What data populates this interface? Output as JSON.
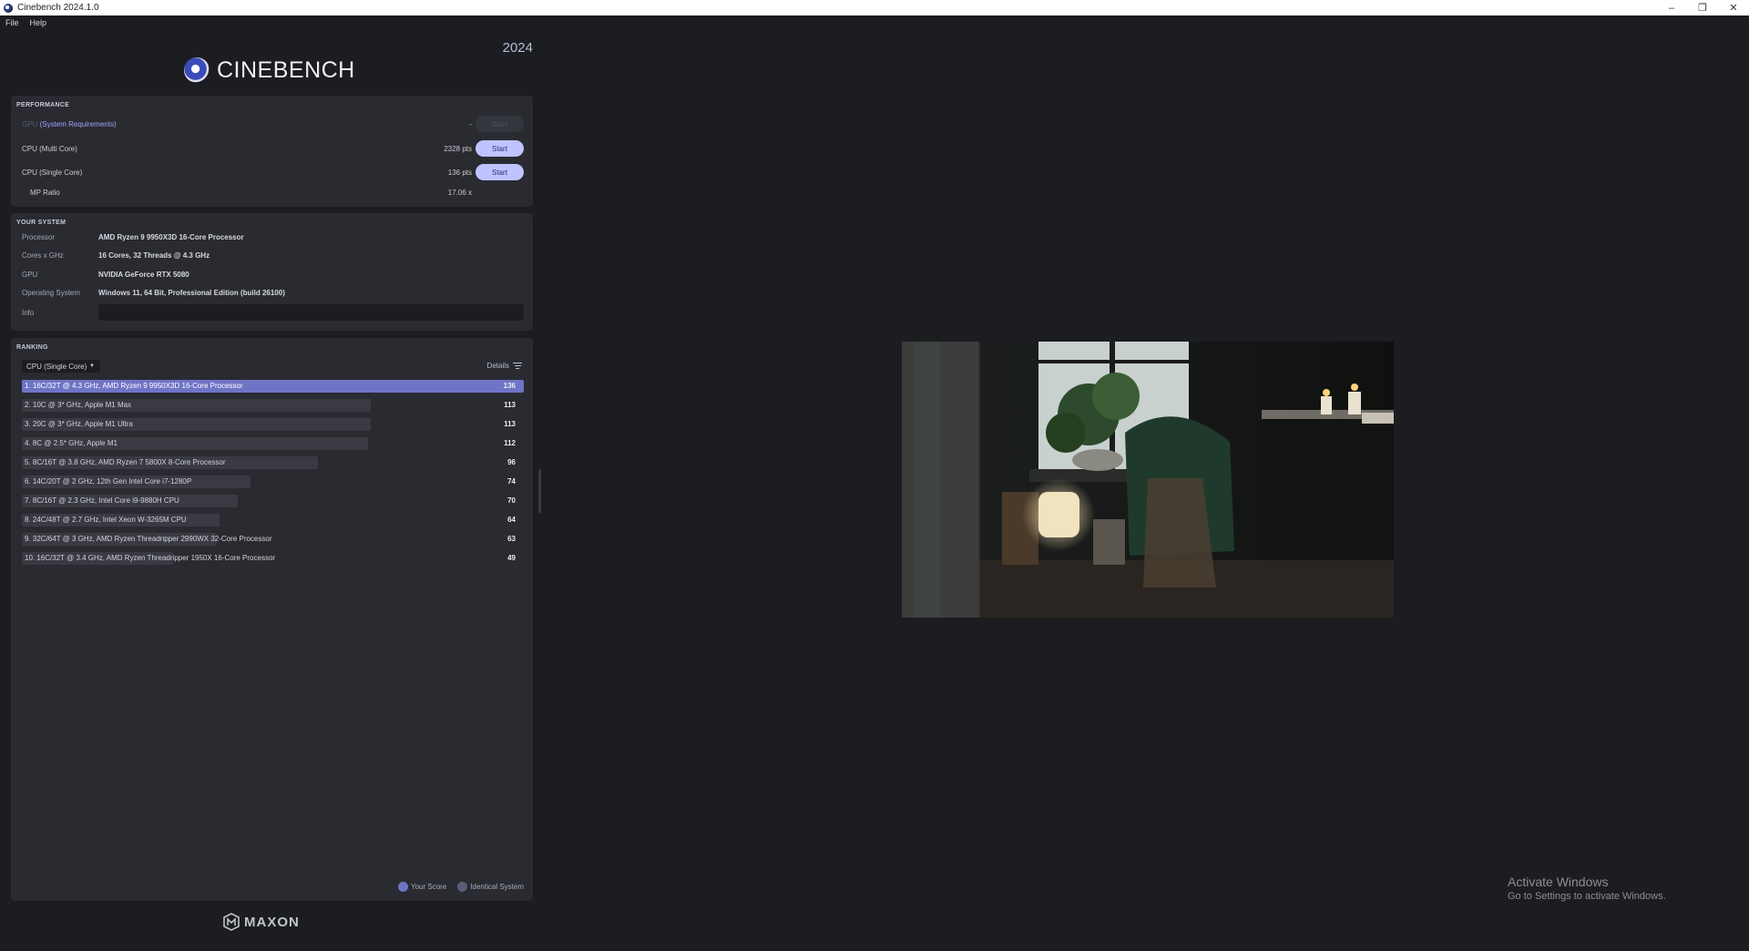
{
  "window": {
    "title": "Cinebench 2024.1.0",
    "controls": [
      "minimize",
      "restore",
      "close"
    ]
  },
  "menu": [
    "File",
    "Help"
  ],
  "header": {
    "logo_text": "CINEBENCH",
    "year": "2024"
  },
  "performance": {
    "title": "PERFORMANCE",
    "gpu": {
      "label_prefix": "GPU",
      "link": "(System Requirements)",
      "score": "-",
      "button": "Start"
    },
    "multi": {
      "label": "CPU (Multi Core)",
      "score": "2328 pts",
      "button": "Start"
    },
    "single": {
      "label": "CPU (Single Core)",
      "score": "136 pts",
      "button": "Start"
    },
    "ratio": {
      "label": "MP Ratio",
      "value": "17.06 x"
    }
  },
  "system": {
    "title": "YOUR SYSTEM",
    "rows": [
      {
        "key": "Processor",
        "value": "AMD Ryzen 9 9950X3D 16-Core Processor"
      },
      {
        "key": "Cores x GHz",
        "value": "16 Cores, 32 Threads @ 4.3 GHz"
      },
      {
        "key": "GPU",
        "value": "NVIDIA GeForce RTX 5080"
      },
      {
        "key": "Operating System",
        "value": "Windows 11, 64 Bit, Professional Edition (build 26100)"
      }
    ],
    "info_label": "Info"
  },
  "ranking": {
    "title": "RANKING",
    "selected": "CPU (Single Core)",
    "details_label": "Details",
    "rows": [
      {
        "name": "1. 16C/32T @ 4.3 GHz, AMD Ryzen 9 9950X3D 16-Core Processor",
        "score": "136",
        "mine": true
      },
      {
        "name": "2. 10C @ 3* GHz, Apple M1 Max",
        "score": "113"
      },
      {
        "name": "3. 20C @ 3* GHz, Apple M1 Ultra",
        "score": "113"
      },
      {
        "name": "4. 8C @ 2.5* GHz, Apple M1",
        "score": "112"
      },
      {
        "name": "5. 8C/16T @ 3.8 GHz, AMD Ryzen 7 5800X 8-Core Processor",
        "score": "96"
      },
      {
        "name": "6. 14C/20T @ 2 GHz, 12th Gen Intel Core i7-1280P",
        "score": "74"
      },
      {
        "name": "7. 8C/16T @ 2.3 GHz, Intel Core i9-9880H CPU",
        "score": "70"
      },
      {
        "name": "8. 24C/48T @ 2.7 GHz, Intel Xeon W-3265M CPU",
        "score": "64"
      },
      {
        "name": "9. 32C/64T @ 3 GHz, AMD Ryzen Threadripper 2990WX 32-Core Processor",
        "score": "63"
      },
      {
        "name": "10. 16C/32T @ 3.4 GHz, AMD Ryzen Threadripper 1950X 16-Core Processor",
        "score": "49"
      }
    ],
    "legend": {
      "yours": "Your Score",
      "identical": "Identical System"
    },
    "colors": {
      "yours": "#6f74c6",
      "identical": "#5a5d78",
      "bar": "#3a3b42"
    }
  },
  "footer": {
    "brand": "MAXON"
  },
  "watermark": {
    "line1": "Activate Windows",
    "line2": "Go to Settings to activate Windows."
  }
}
